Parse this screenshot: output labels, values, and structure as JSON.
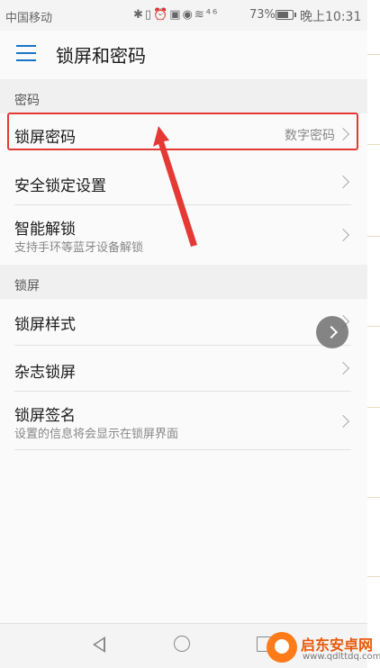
{
  "status_bar": {
    "carrier": "中国移动",
    "icons": [
      "bluetooth-icon",
      "vibrate-icon",
      "alarm-icon",
      "hd-icon",
      "eye-icon",
      "wifi-icon",
      "signal-4g-icon"
    ],
    "icon_glyphs": "✱▯⏰▣◉≋⁴⁶",
    "battery_percent": "73%",
    "battery_level": 0.73,
    "time": "晚上10:31"
  },
  "toolbar": {
    "title": "锁屏和密码"
  },
  "sections": [
    {
      "header": "密码",
      "items": [
        {
          "label": "锁屏密码",
          "value": "数字密码",
          "subtitle": ""
        },
        {
          "label": "安全锁定设置",
          "value": "",
          "subtitle": ""
        },
        {
          "label": "智能解锁",
          "value": "",
          "subtitle": "支持手环等蓝牙设备解锁"
        }
      ]
    },
    {
      "header": "锁屏",
      "items": [
        {
          "label": "锁屏样式",
          "value": "",
          "subtitle": ""
        },
        {
          "label": "杂志锁屏",
          "value": "",
          "subtitle": ""
        },
        {
          "label": "锁屏签名",
          "value": "",
          "subtitle": "设置的信息将会显示在锁屏界面"
        }
      ]
    }
  ],
  "annotation": {
    "color": "#e53935"
  },
  "watermark": {
    "name": "启东安卓网",
    "url": "www.qdlttdq.com"
  },
  "colors": {
    "accent": "#1a73c7",
    "annotation_red": "#e53935",
    "watermark_orange": "#e8590c"
  }
}
